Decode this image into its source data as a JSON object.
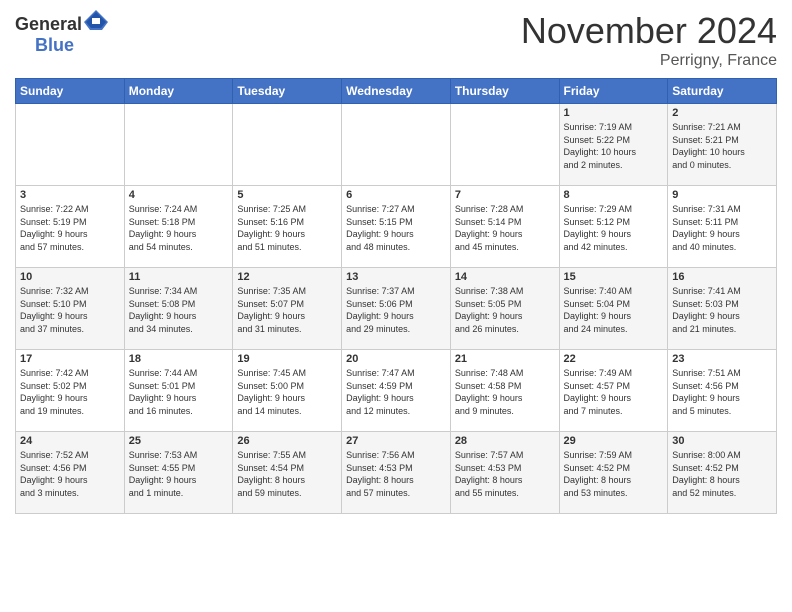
{
  "header": {
    "logo": {
      "general": "General",
      "blue": "Blue"
    },
    "title": "November 2024",
    "location": "Perrigny, France"
  },
  "days_of_week": [
    "Sunday",
    "Monday",
    "Tuesday",
    "Wednesday",
    "Thursday",
    "Friday",
    "Saturday"
  ],
  "weeks": [
    [
      {
        "day": "",
        "info": ""
      },
      {
        "day": "",
        "info": ""
      },
      {
        "day": "",
        "info": ""
      },
      {
        "day": "",
        "info": ""
      },
      {
        "day": "",
        "info": ""
      },
      {
        "day": "1",
        "info": "Sunrise: 7:19 AM\nSunset: 5:22 PM\nDaylight: 10 hours\nand 2 minutes."
      },
      {
        "day": "2",
        "info": "Sunrise: 7:21 AM\nSunset: 5:21 PM\nDaylight: 10 hours\nand 0 minutes."
      }
    ],
    [
      {
        "day": "3",
        "info": "Sunrise: 7:22 AM\nSunset: 5:19 PM\nDaylight: 9 hours\nand 57 minutes."
      },
      {
        "day": "4",
        "info": "Sunrise: 7:24 AM\nSunset: 5:18 PM\nDaylight: 9 hours\nand 54 minutes."
      },
      {
        "day": "5",
        "info": "Sunrise: 7:25 AM\nSunset: 5:16 PM\nDaylight: 9 hours\nand 51 minutes."
      },
      {
        "day": "6",
        "info": "Sunrise: 7:27 AM\nSunset: 5:15 PM\nDaylight: 9 hours\nand 48 minutes."
      },
      {
        "day": "7",
        "info": "Sunrise: 7:28 AM\nSunset: 5:14 PM\nDaylight: 9 hours\nand 45 minutes."
      },
      {
        "day": "8",
        "info": "Sunrise: 7:29 AM\nSunset: 5:12 PM\nDaylight: 9 hours\nand 42 minutes."
      },
      {
        "day": "9",
        "info": "Sunrise: 7:31 AM\nSunset: 5:11 PM\nDaylight: 9 hours\nand 40 minutes."
      }
    ],
    [
      {
        "day": "10",
        "info": "Sunrise: 7:32 AM\nSunset: 5:10 PM\nDaylight: 9 hours\nand 37 minutes."
      },
      {
        "day": "11",
        "info": "Sunrise: 7:34 AM\nSunset: 5:08 PM\nDaylight: 9 hours\nand 34 minutes."
      },
      {
        "day": "12",
        "info": "Sunrise: 7:35 AM\nSunset: 5:07 PM\nDaylight: 9 hours\nand 31 minutes."
      },
      {
        "day": "13",
        "info": "Sunrise: 7:37 AM\nSunset: 5:06 PM\nDaylight: 9 hours\nand 29 minutes."
      },
      {
        "day": "14",
        "info": "Sunrise: 7:38 AM\nSunset: 5:05 PM\nDaylight: 9 hours\nand 26 minutes."
      },
      {
        "day": "15",
        "info": "Sunrise: 7:40 AM\nSunset: 5:04 PM\nDaylight: 9 hours\nand 24 minutes."
      },
      {
        "day": "16",
        "info": "Sunrise: 7:41 AM\nSunset: 5:03 PM\nDaylight: 9 hours\nand 21 minutes."
      }
    ],
    [
      {
        "day": "17",
        "info": "Sunrise: 7:42 AM\nSunset: 5:02 PM\nDaylight: 9 hours\nand 19 minutes."
      },
      {
        "day": "18",
        "info": "Sunrise: 7:44 AM\nSunset: 5:01 PM\nDaylight: 9 hours\nand 16 minutes."
      },
      {
        "day": "19",
        "info": "Sunrise: 7:45 AM\nSunset: 5:00 PM\nDaylight: 9 hours\nand 14 minutes."
      },
      {
        "day": "20",
        "info": "Sunrise: 7:47 AM\nSunset: 4:59 PM\nDaylight: 9 hours\nand 12 minutes."
      },
      {
        "day": "21",
        "info": "Sunrise: 7:48 AM\nSunset: 4:58 PM\nDaylight: 9 hours\nand 9 minutes."
      },
      {
        "day": "22",
        "info": "Sunrise: 7:49 AM\nSunset: 4:57 PM\nDaylight: 9 hours\nand 7 minutes."
      },
      {
        "day": "23",
        "info": "Sunrise: 7:51 AM\nSunset: 4:56 PM\nDaylight: 9 hours\nand 5 minutes."
      }
    ],
    [
      {
        "day": "24",
        "info": "Sunrise: 7:52 AM\nSunset: 4:56 PM\nDaylight: 9 hours\nand 3 minutes."
      },
      {
        "day": "25",
        "info": "Sunrise: 7:53 AM\nSunset: 4:55 PM\nDaylight: 9 hours\nand 1 minute."
      },
      {
        "day": "26",
        "info": "Sunrise: 7:55 AM\nSunset: 4:54 PM\nDaylight: 8 hours\nand 59 minutes."
      },
      {
        "day": "27",
        "info": "Sunrise: 7:56 AM\nSunset: 4:53 PM\nDaylight: 8 hours\nand 57 minutes."
      },
      {
        "day": "28",
        "info": "Sunrise: 7:57 AM\nSunset: 4:53 PM\nDaylight: 8 hours\nand 55 minutes."
      },
      {
        "day": "29",
        "info": "Sunrise: 7:59 AM\nSunset: 4:52 PM\nDaylight: 8 hours\nand 53 minutes."
      },
      {
        "day": "30",
        "info": "Sunrise: 8:00 AM\nSunset: 4:52 PM\nDaylight: 8 hours\nand 52 minutes."
      }
    ]
  ]
}
